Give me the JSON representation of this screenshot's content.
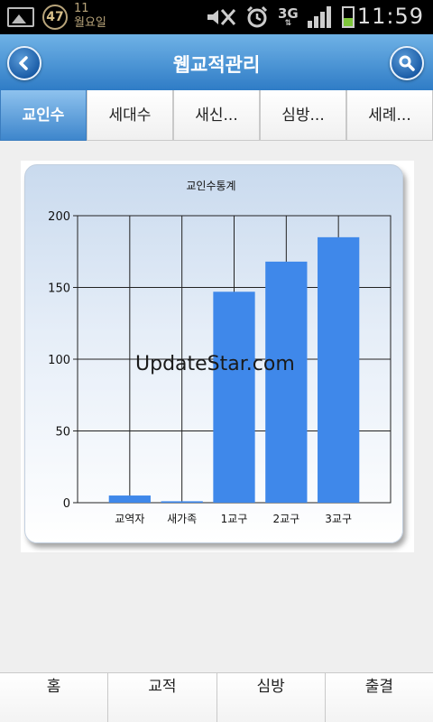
{
  "status_bar": {
    "badge": "47",
    "date_line1": "11",
    "date_line2": "월요일",
    "network": "3G",
    "time": "11:59",
    "icons": [
      "gallery-icon",
      "mute-icon",
      "alarm-icon",
      "signal-icon",
      "battery-icon"
    ]
  },
  "header": {
    "title": "웹교적관리",
    "back_icon": "back-icon",
    "search_icon": "search-icon",
    "accent": "#3e86cc"
  },
  "tabs": [
    {
      "label": "교인수",
      "active": true
    },
    {
      "label": "세대수",
      "active": false
    },
    {
      "label": "새신...",
      "active": false
    },
    {
      "label": "심방...",
      "active": false
    },
    {
      "label": "세례...",
      "active": false
    }
  ],
  "chart_data": {
    "type": "bar",
    "title": "교인수통계",
    "categories": [
      "교역자",
      "새가족",
      "1교구",
      "2교구",
      "3교구"
    ],
    "values": [
      5,
      1,
      147,
      168,
      185
    ],
    "ylim": [
      0,
      200
    ],
    "yticks": [
      0,
      50,
      100,
      150,
      200
    ],
    "xlabel": "",
    "ylabel": "",
    "grid": true,
    "bar_color": "#3f88ea"
  },
  "watermark": "UpdateStar.com",
  "bottom_nav": [
    {
      "label": "홈"
    },
    {
      "label": "교적"
    },
    {
      "label": "심방"
    },
    {
      "label": "출결"
    }
  ]
}
